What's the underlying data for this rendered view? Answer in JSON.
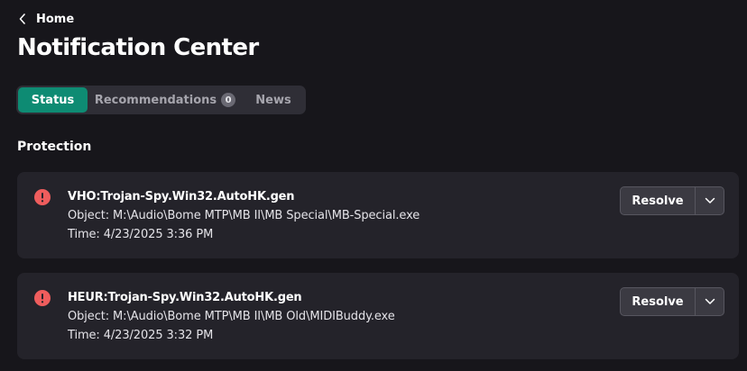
{
  "breadcrumb": {
    "label": "Home",
    "icon": "chevron-left-icon"
  },
  "page": {
    "title": "Notification Center"
  },
  "tabs": [
    {
      "label": "Status",
      "active": true
    },
    {
      "label": "Recommendations",
      "badge": "0",
      "active": false
    },
    {
      "label": "News",
      "active": false
    }
  ],
  "section": {
    "title": "Protection"
  },
  "notifications": [
    {
      "icon": "error-alert-icon",
      "threat": "VHO:Trojan-Spy.Win32.AutoHK.gen",
      "object": "Object: M:\\Audio\\Bome MTP\\MB II\\MB Special\\MB-Special.exe",
      "time": "Time: 4/23/2025 3:36 PM",
      "action_label": "Resolve"
    },
    {
      "icon": "error-alert-icon",
      "threat": "HEUR:Trojan-Spy.Win32.AutoHK.gen",
      "object": "Object: M:\\Audio\\Bome MTP\\MB II\\MB Old\\MIDIBuddy.exe",
      "time": "Time: 4/23/2025 3:32 PM",
      "action_label": "Resolve"
    }
  ],
  "colors": {
    "background": "#17161b",
    "card": "#24232a",
    "accent": "#0e8b73",
    "alert": "#ef5d5d",
    "tab_bar": "#2f2e36"
  }
}
